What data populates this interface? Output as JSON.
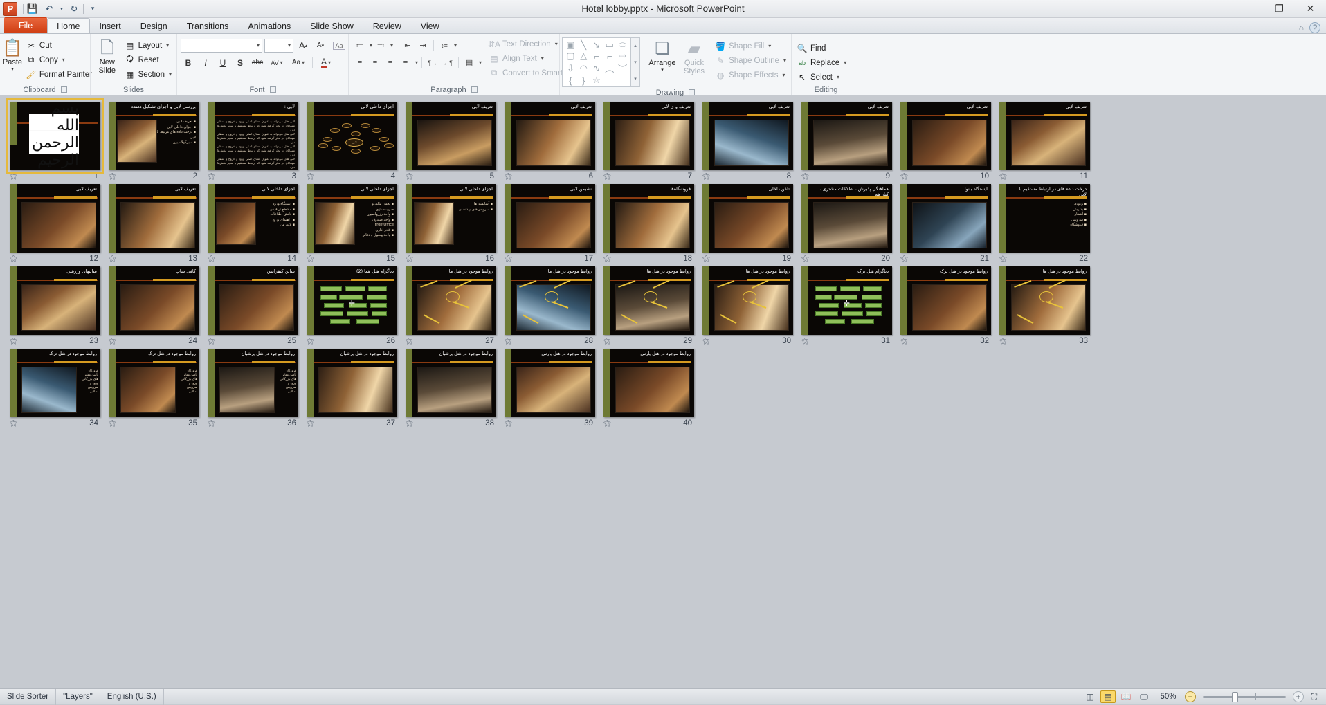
{
  "window": {
    "title": "Hotel lobby.pptx  -  Microsoft PowerPoint",
    "logo": "P",
    "minimize": "—",
    "restore": "❐",
    "close": "✕"
  },
  "quick_access": {
    "save": "💾",
    "undo": "↶",
    "undo_caret": "▾",
    "redo": "↻",
    "customize": "▾"
  },
  "tabs": [
    {
      "label": "File",
      "id": "file"
    },
    {
      "label": "Home",
      "id": "home"
    },
    {
      "label": "Insert",
      "id": "insert"
    },
    {
      "label": "Design",
      "id": "design"
    },
    {
      "label": "Transitions",
      "id": "transitions"
    },
    {
      "label": "Animations",
      "id": "animations"
    },
    {
      "label": "Slide Show",
      "id": "slideshow"
    },
    {
      "label": "Review",
      "id": "review"
    },
    {
      "label": "View",
      "id": "view"
    }
  ],
  "ribbon_help": {
    "minimize_ribbon": "⌂",
    "help": "?"
  },
  "groups": {
    "clipboard": {
      "label": "Clipboard",
      "paste": "Paste",
      "paste_caret": "▾",
      "cut": "Cut",
      "copy": "Copy",
      "copy_caret": "▾",
      "format_painter": "Format Painter"
    },
    "slides": {
      "label": "Slides",
      "new_slide": "New\nSlide",
      "new_slide_line1": "New",
      "new_slide_line2": "Slide",
      "layout": "Layout",
      "reset": "Reset",
      "section": "Section"
    },
    "font": {
      "label": "Font",
      "font_name": "",
      "font_name_placeholder": "",
      "font_size": "",
      "grow": "A",
      "shrink": "A",
      "clear_formatting": "Aa",
      "bold": "B",
      "italic": "I",
      "underline": "U",
      "shadow": "S",
      "strikethrough": "abc",
      "character_spacing": "AV",
      "change_case": "Aa",
      "font_color": "A"
    },
    "paragraph": {
      "label": "Paragraph",
      "bullets": "≔",
      "numbering": "≕",
      "decrease_indent": "⇤",
      "increase_indent": "⇥",
      "line_spacing": "↕≡",
      "align_left": "≡",
      "align_center": "≡",
      "align_right": "≡",
      "justify": "≡",
      "columns": "▤",
      "ltr": "¶→",
      "rtl": "←¶",
      "text_direction": "Text Direction",
      "align_text": "Align Text",
      "convert_to_smartart": "Convert to SmartArt"
    },
    "drawing": {
      "label": "Drawing",
      "shapes": [
        "▣",
        "╲",
        "↘",
        "▭",
        "⬭",
        "▢",
        "△",
        "⌐",
        "⌐",
        "⇨",
        "⇩",
        "◠",
        "∿",
        "︵",
        "︶",
        "{",
        "}",
        "☆"
      ],
      "arrange": "Arrange",
      "quick_styles_line1": "Quick",
      "quick_styles_line2": "Styles",
      "shape_fill": "Shape Fill",
      "shape_outline": "Shape Outline",
      "shape_effects": "Shape Effects"
    },
    "editing": {
      "label": "Editing",
      "find": "Find",
      "replace": "Replace",
      "select": "Select"
    }
  },
  "status_bar": {
    "view_name": "Slide Sorter",
    "theme": "\"Layers\"",
    "language": "English (U.S.)",
    "zoom_level": "50%",
    "views": [
      {
        "name": "normal-view",
        "glyph": "◫"
      },
      {
        "name": "slide-sorter-view",
        "glyph": "▤",
        "active": true
      },
      {
        "name": "reading-view",
        "glyph": "📖"
      },
      {
        "name": "slide-show-view",
        "glyph": "🖵"
      }
    ],
    "zoom_out": "−",
    "zoom_in": "+",
    "fit_to_window": "⛶"
  },
  "slides": [
    {
      "n": 1,
      "title": "",
      "kind": "calligraphy",
      "calligraphy": "بسم الله الرحمن الرحیم"
    },
    {
      "n": 2,
      "title": "بررسی لابی و اجزای تشکیل دهنده",
      "kind": "bullets-photo",
      "photo": "p1",
      "bullets": [
        "تعریف لابی",
        "اجزای داخلی لابی",
        "درخت داده های مرتبط با لابی",
        "سیرکولاسیون"
      ]
    },
    {
      "n": 3,
      "title": "لابی :",
      "kind": "paragraph"
    },
    {
      "n": 4,
      "title": "اجزای داخلی لابی",
      "kind": "diagram-oval"
    },
    {
      "n": 5,
      "title": "تعریف لابی",
      "kind": "photo",
      "photo": "p2"
    },
    {
      "n": 6,
      "title": "تعریف لابی",
      "kind": "photo",
      "photo": "p3"
    },
    {
      "n": 7,
      "title": "تعریف و ی لابی",
      "kind": "photo",
      "photo": "p7"
    },
    {
      "n": 8,
      "title": "تعریف لابی",
      "kind": "photo",
      "photo": "p4"
    },
    {
      "n": 9,
      "title": "تعریف لابی",
      "kind": "photo",
      "photo": "p6"
    },
    {
      "n": 10,
      "title": "تعریف لابی",
      "kind": "photo",
      "photo": "p5"
    },
    {
      "n": 11,
      "title": "تعریف لابی",
      "kind": "photo",
      "photo": "p1"
    },
    {
      "n": 12,
      "title": "تعریف لابی",
      "kind": "photo",
      "photo": "p5"
    },
    {
      "n": 13,
      "title": "تعریف لابی",
      "kind": "photo",
      "photo": "p3"
    },
    {
      "n": 14,
      "title": "اجزای داخلی لابی",
      "kind": "bullets-photo",
      "photo": "p5",
      "bullets": [
        "ایستگاه ورود",
        "مقاطع ترافیکی",
        "دانش اطلاعات",
        "راهنمای ورود",
        "لابی من"
      ]
    },
    {
      "n": 15,
      "title": "اجزای داخلی لابی",
      "kind": "bullets-photo",
      "photo": "p7",
      "bullets": [
        "بخش مالی و صورت‌سازی",
        "واحد رزرواسیون",
        "واحد صندوق FrontOffice",
        "کادر اداری",
        "واحد وصول و دفاتر"
      ]
    },
    {
      "n": 16,
      "title": "اجزای داخلی لابی",
      "kind": "bullets-photo",
      "photo": "p7",
      "bullets": [
        "آسانسورها",
        "سرویس‌های بهداشتی"
      ]
    },
    {
      "n": 17,
      "title": "نشیمن لابی",
      "kind": "photo",
      "photo": "p5"
    },
    {
      "n": 18,
      "title": "فروشگاه‌ها",
      "kind": "photo",
      "photo": "p3"
    },
    {
      "n": 19,
      "title": "تلفن داخلی",
      "kind": "photo",
      "photo": "p5"
    },
    {
      "n": 20,
      "title": "هماهنگی پذیرش ، اطلاعات مشتری ، کنار هم",
      "kind": "photo",
      "photo": "p6"
    },
    {
      "n": 21,
      "title": "ایستگاه بانوا",
      "kind": "photo",
      "photo": "p8"
    },
    {
      "n": 22,
      "title": "درخت داده های در ارتباط مستقیم با لابی",
      "kind": "bullets",
      "bullets": [
        "ورودی",
        "پذیرش",
        "انتظار",
        "سرویس",
        "فروشگاه"
      ]
    },
    {
      "n": 23,
      "title": "سالنهای ورزشی",
      "kind": "photo",
      "photo": "p1"
    },
    {
      "n": 24,
      "title": "کافی شاپ",
      "kind": "photo",
      "photo": "p5"
    },
    {
      "n": 25,
      "title": "سالن کنفرانس",
      "kind": "photo",
      "photo": "p5"
    },
    {
      "n": 26,
      "title": "دیاگرام هتل هما (2)",
      "kind": "diagram-green"
    },
    {
      "n": 27,
      "title": "روابط موجود در هتل ها",
      "kind": "photo-arrows",
      "photo": "p3"
    },
    {
      "n": 28,
      "title": "روابط موجود در هتل ها",
      "kind": "photo-arrows",
      "photo": "p4"
    },
    {
      "n": 29,
      "title": "روابط موجود در هتل ها",
      "kind": "photo-arrows",
      "photo": "p6"
    },
    {
      "n": 30,
      "title": "روابط موجود در هتل ها",
      "kind": "photo-arrows",
      "photo": "p7"
    },
    {
      "n": 31,
      "title": "دیاگرام هتل ترک",
      "kind": "diagram-green"
    },
    {
      "n": 32,
      "title": "روابط موجود در هتل ترک",
      "kind": "photo",
      "photo": "p5"
    },
    {
      "n": 33,
      "title": "روابط موجود در هتل ها",
      "kind": "photo-arrows",
      "photo": "p3"
    },
    {
      "n": 34,
      "title": "روابط موجود در هتل ترک",
      "kind": "photo-text",
      "photo": "p4"
    },
    {
      "n": 35,
      "title": "روابط موجود در هتل ترک",
      "kind": "photo-text",
      "photo": "p5"
    },
    {
      "n": 36,
      "title": "روابط موجود در هتل پرشیان",
      "kind": "photo-text",
      "photo": "p6"
    },
    {
      "n": 37,
      "title": "روابط موجود در هتل پرشیان",
      "kind": "photo",
      "photo": "p7"
    },
    {
      "n": 38,
      "title": "روابط موجود در هتل پرشیان",
      "kind": "photo",
      "photo": "p6"
    },
    {
      "n": 39,
      "title": "روابط موجود در هتل پارس",
      "kind": "photo",
      "photo": "p1"
    },
    {
      "n": 40,
      "title": "روابط موجود در هتل پارس",
      "kind": "photo",
      "photo": "p5"
    }
  ],
  "transition_icon": "⚝"
}
